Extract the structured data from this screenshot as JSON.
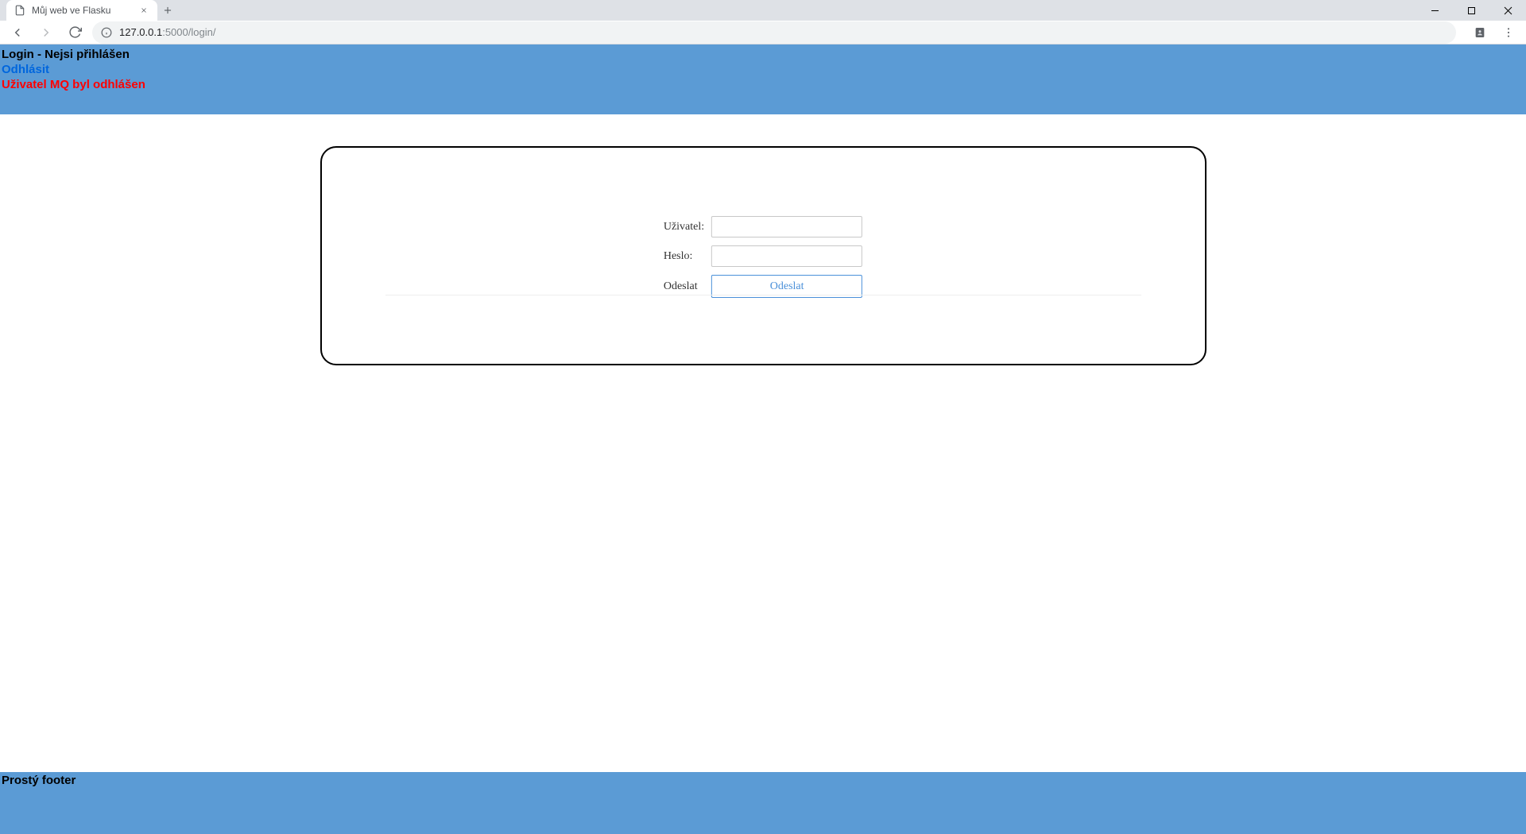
{
  "browser": {
    "tab_title": "Můj web ve Flasku",
    "url_host": "127.0.0.1",
    "url_port_path": ":5000/login/"
  },
  "banner": {
    "title": "Login - Nejsi přihlášen",
    "logout_link": "Odhlásit",
    "flash": "Uživatel MQ byl odhlášen"
  },
  "form": {
    "user_label": "Uživatel:",
    "password_label": "Heslo:",
    "submit_row_label": "Odeslat",
    "submit_button": "Odeslat",
    "user_value": "",
    "password_value": ""
  },
  "footer": {
    "text": "Prostý footer"
  }
}
